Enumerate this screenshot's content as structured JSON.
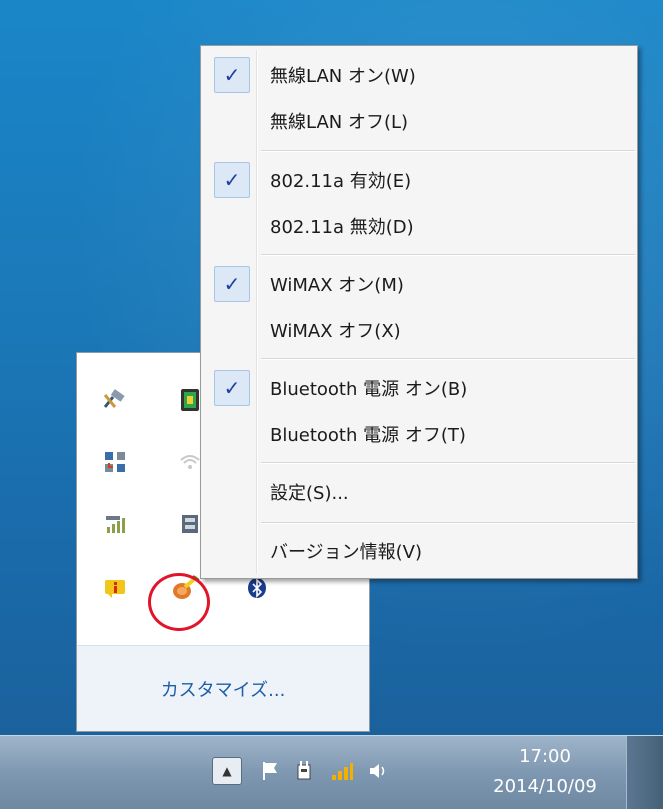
{
  "context_menu": {
    "items": [
      {
        "label": "無線LAN オン(W)",
        "checked": true
      },
      {
        "label": "無線LAN オフ(L)",
        "checked": false
      },
      {
        "label": "802.11a 有効(E)",
        "checked": true
      },
      {
        "label": "802.11a 無効(D)",
        "checked": false
      },
      {
        "label": "WiMAX オン(M)",
        "checked": true
      },
      {
        "label": "WiMAX オフ(X)",
        "checked": false
      },
      {
        "label": "Bluetooth 電源 オン(B)",
        "checked": true
      },
      {
        "label": "Bluetooth 電源 オフ(T)",
        "checked": false
      },
      {
        "label": "設定(S)...",
        "checked": false
      },
      {
        "label": "バージョン情報(V)",
        "checked": false
      }
    ],
    "check_glyph": "✓"
  },
  "tray_popup": {
    "customize_label": "カスタマイズ..."
  },
  "taskbar": {
    "time": "17:00",
    "date": "2014/10/09",
    "up_arrow_glyph": "▲"
  },
  "colors": {
    "desktop": "#1a78b8",
    "check_blue": "#1f3f9e",
    "highlight_circle": "#e2142a",
    "link_blue": "#1e5ea8"
  }
}
